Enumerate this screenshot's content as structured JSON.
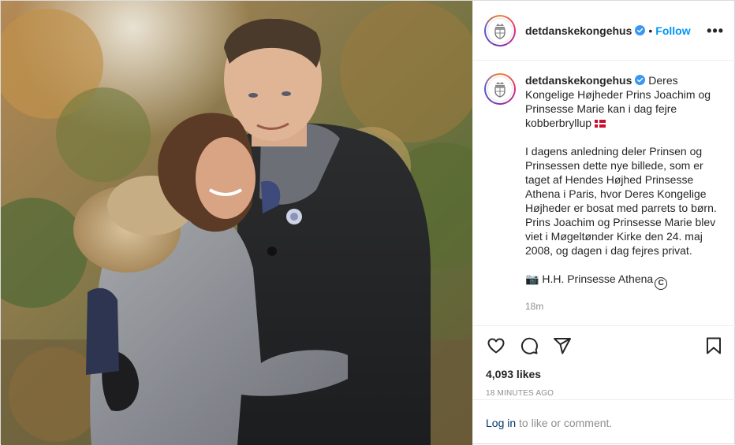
{
  "photo": {
    "alt": ""
  },
  "header": {
    "username": "detdanskekongehus",
    "separator": "•",
    "follow_label": "Follow",
    "more_label": "•••"
  },
  "caption": {
    "username": "detdanskekongehus",
    "paragraph1": "Deres Kongelige Højheder Prins Joachim og Prinsesse Marie kan i dag fejre kobberbryllup",
    "paragraph2": "I dagens anledning deler Prinsen og Prinsessen dette nye billede, som er taget af Hendes Højhed Prinsesse Athena i Paris, hvor Deres Kongelige Højheder er bosat med parrets to børn. Prins Joachim og Prinsesse Marie blev viet i Møgeltønder Kirke den 24. maj 2008, og dagen i dag fejres privat.",
    "camera_emoji": "📷",
    "credit": "H.H. Prinsesse Athena",
    "copyright_symbol": "C",
    "time_ago": "18m"
  },
  "actions": {
    "likes": "4,093 likes",
    "post_time": "18 MINUTES AGO"
  },
  "comment": {
    "login_label": "Log in",
    "rest_text": " to like or comment."
  },
  "colors": {
    "accent": "#0095f6",
    "verified": "#3897f0",
    "link_dark": "#00376b",
    "muted": "#8e8e8e"
  }
}
